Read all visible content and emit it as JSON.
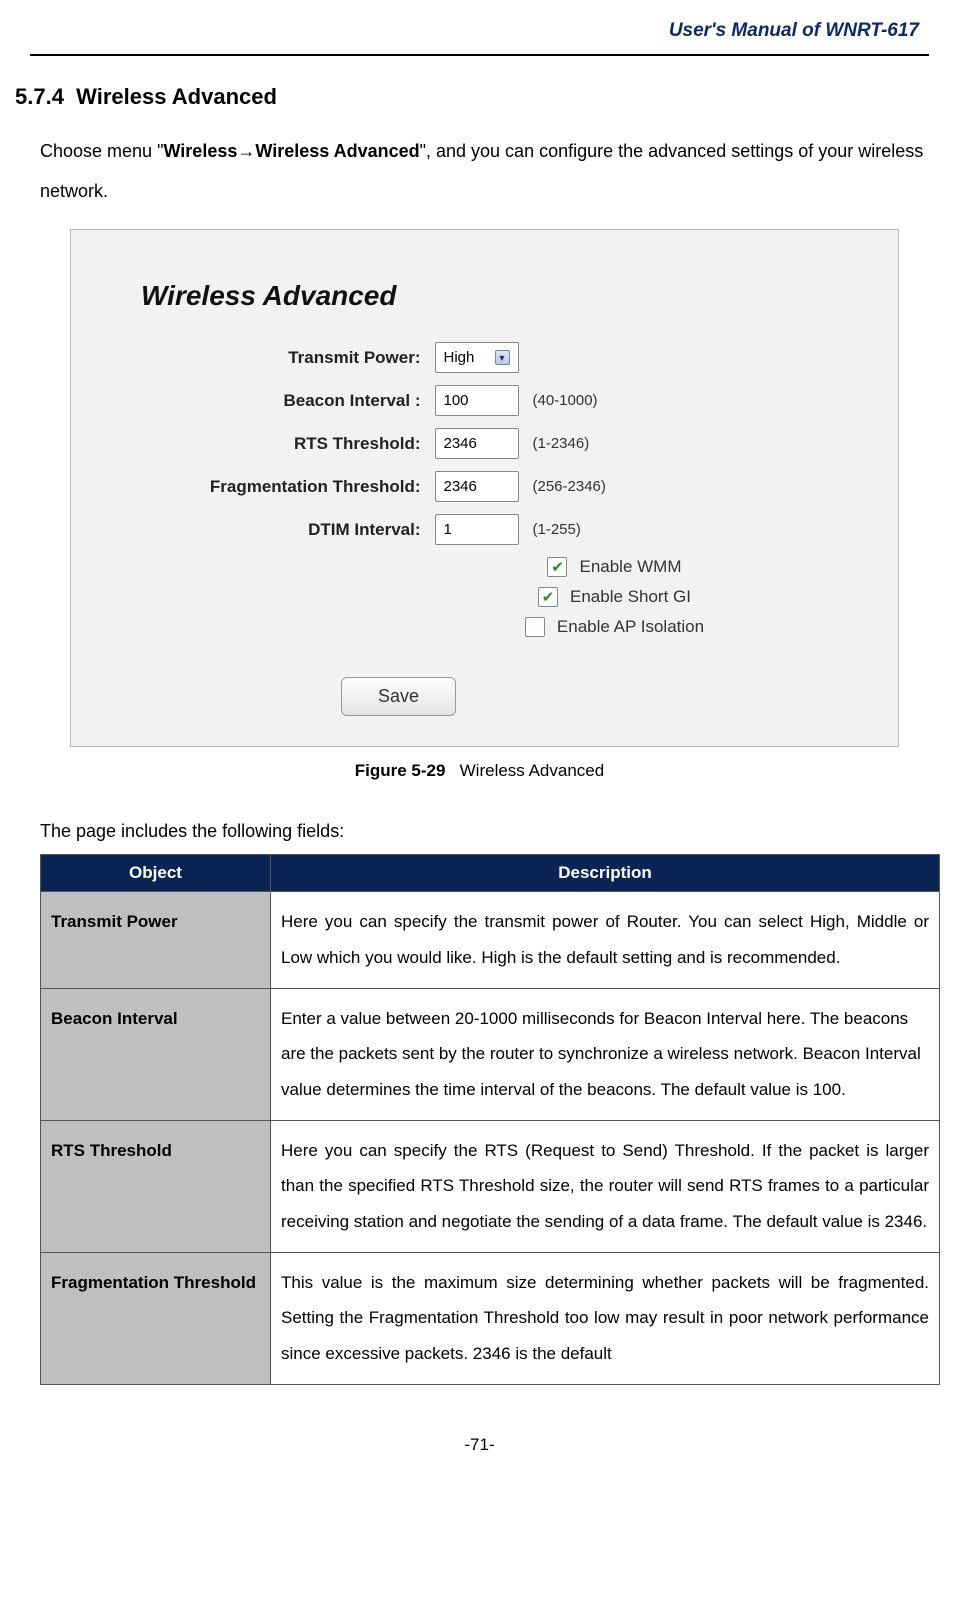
{
  "header": {
    "manual_title": "User's Manual of WNRT-617"
  },
  "section": {
    "number": "5.7.4",
    "title": "Wireless Advanced",
    "intro_prefix": "Choose menu \"",
    "intro_bold1": "Wireless",
    "intro_arrow": "→",
    "intro_bold2": "Wireless Advanced",
    "intro_suffix": "\", and you can configure the advanced settings of your wireless network."
  },
  "figure": {
    "panel_title": "Wireless Advanced",
    "labels": {
      "transmit": "Transmit Power:",
      "beacon": "Beacon Interval :",
      "rts": "RTS Threshold:",
      "frag": "Fragmentation Threshold:",
      "dtim": "DTIM Interval:"
    },
    "values": {
      "transmit": "High",
      "beacon": "100",
      "rts": "2346",
      "frag": "2346",
      "dtim": "1"
    },
    "hints": {
      "beacon": "(40-1000)",
      "rts": "(1-2346)",
      "frag": "(256-2346)",
      "dtim": "(1-255)"
    },
    "checkboxes": {
      "wmm": "Enable WMM",
      "shortgi": "Enable Short GI",
      "apiso": "Enable AP Isolation"
    },
    "save": "Save",
    "caption_bold": "Figure 5-29",
    "caption_rest": "Wireless Advanced"
  },
  "fields_intro": "The page includes the following fields:",
  "table": {
    "head_object": "Object",
    "head_desc": "Description",
    "rows": [
      {
        "obj": "Transmit Power",
        "desc": "Here you can specify the transmit power of Router. You can select High, Middle or Low which you would like. High is the default setting and is recommended."
      },
      {
        "obj": "Beacon Interval",
        "desc": "Enter a value between 20-1000 milliseconds for Beacon Interval here. The beacons are the packets sent by the router to synchronize a wireless network. Beacon Interval value determines the time interval of the beacons. The default value is 100."
      },
      {
        "obj": "RTS Threshold",
        "desc": "Here you can specify the RTS (Request to Send) Threshold. If the packet is larger than the specified RTS Threshold size, the router will send RTS frames to a particular receiving station and negotiate the sending of a data frame. The default value is 2346."
      },
      {
        "obj": "Fragmentation Threshold",
        "desc": "This value is the maximum size determining whether packets will be fragmented. Setting the Fragmentation Threshold too low may result in poor network performance since excessive packets. 2346 is the default"
      }
    ]
  },
  "page_number": "-71-"
}
